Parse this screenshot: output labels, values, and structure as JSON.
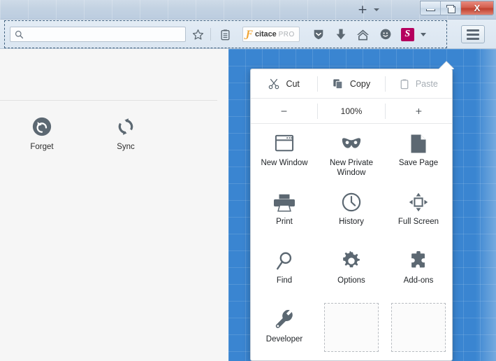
{
  "window": {
    "controls": [
      {
        "name": "minimize",
        "label": "–"
      },
      {
        "name": "restore",
        "label": ""
      },
      {
        "name": "close",
        "label": "X"
      }
    ],
    "new_tab_label": "+",
    "tab_list_label": "▾"
  },
  "toolbar": {
    "search": {
      "value": "",
      "placeholder": "",
      "icon": "search-icon"
    },
    "bookmark_icon": "star-icon",
    "reader_icon": "reader-list-icon",
    "citace": {
      "glyph": "Ƒ",
      "name": "citace",
      "pro": "PRO"
    },
    "shield_icon": "shield-icon",
    "downloads_icon": "download-arrow-icon",
    "home_icon": "home-icon",
    "chat_icon": "smiley-chat-icon",
    "s_badge": "S",
    "overflow_chevron": "chevron-down-icon",
    "menu_button_icon": "hamburger-menu-icon"
  },
  "customize_area": {
    "widgets": [
      {
        "id": "forget",
        "label": "Forget",
        "icon": "forget-icon"
      },
      {
        "id": "sync",
        "label": "Sync",
        "icon": "sync-icon"
      }
    ]
  },
  "panel": {
    "edit_row": [
      {
        "id": "cut",
        "label": "Cut",
        "icon": "scissors-icon",
        "disabled": false
      },
      {
        "id": "copy",
        "label": "Copy",
        "icon": "copy-icon",
        "disabled": false
      },
      {
        "id": "paste",
        "label": "Paste",
        "icon": "clipboard-icon",
        "disabled": true
      }
    ],
    "zoom_row": {
      "minus_label": "−",
      "level": "100%",
      "plus_label": "+"
    },
    "items": [
      {
        "id": "new-window",
        "label": "New Window",
        "icon": "window-icon"
      },
      {
        "id": "new-private-window",
        "label": "New Private Window",
        "icon": "mask-icon"
      },
      {
        "id": "save-page",
        "label": "Save Page",
        "icon": "page-icon"
      },
      {
        "id": "print",
        "label": "Print",
        "icon": "printer-icon"
      },
      {
        "id": "history",
        "label": "History",
        "icon": "clock-icon"
      },
      {
        "id": "full-screen",
        "label": "Full Screen",
        "icon": "fullscreen-icon"
      },
      {
        "id": "find",
        "label": "Find",
        "icon": "magnifier-icon"
      },
      {
        "id": "options",
        "label": "Options",
        "icon": "gear-icon"
      },
      {
        "id": "add-ons",
        "label": "Add-ons",
        "icon": "puzzle-icon"
      },
      {
        "id": "developer",
        "label": "Developer",
        "icon": "wrench-icon"
      },
      {
        "id": "empty-slot-1",
        "label": "",
        "icon": "empty-drop-target"
      },
      {
        "id": "empty-slot-2",
        "label": "",
        "icon": "empty-drop-target"
      }
    ]
  },
  "colors": {
    "accent_blue": "#3a85d1",
    "s_badge_bg": "#b5005e",
    "icon_gray": "#5c6872",
    "close_red": "#c0412f",
    "citace_orange": "#f0a22e"
  }
}
